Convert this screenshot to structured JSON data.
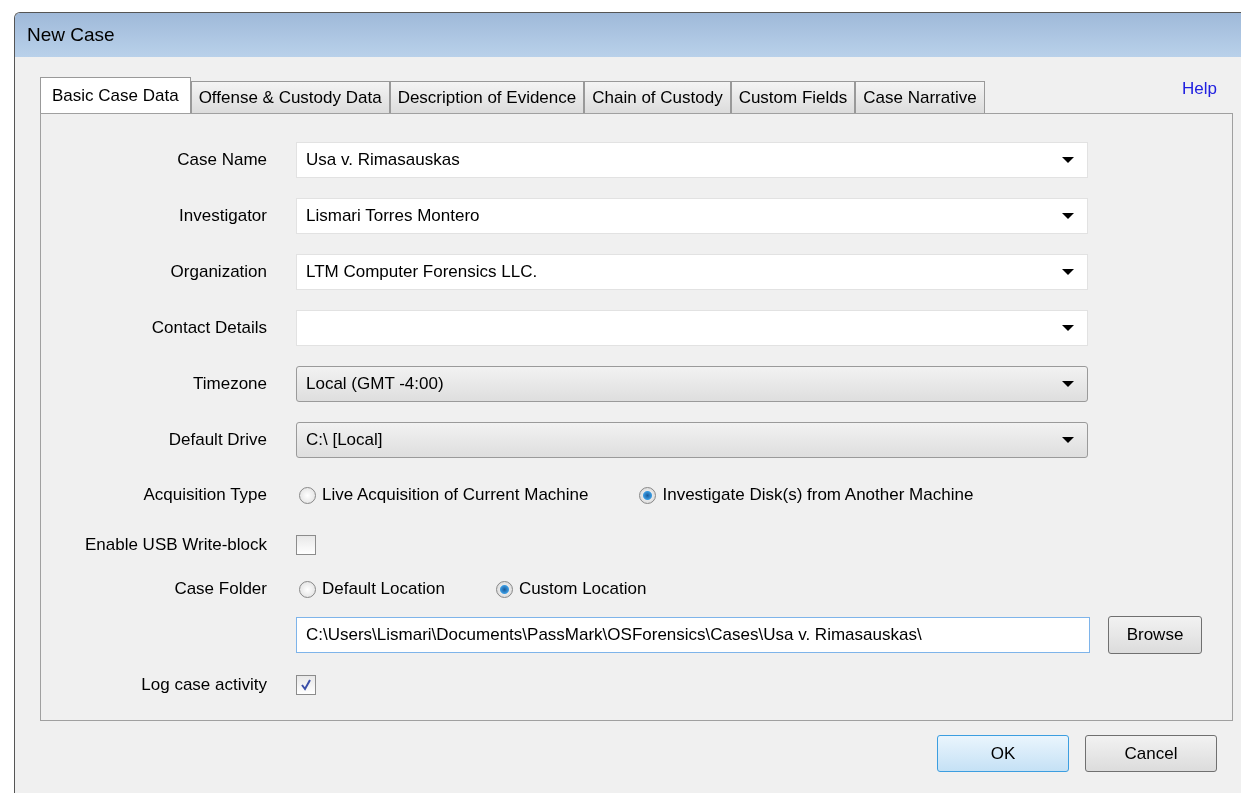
{
  "window": {
    "title": "New Case"
  },
  "tabs": [
    {
      "label": "Basic Case Data",
      "selected": true
    },
    {
      "label": "Offense & Custody Data",
      "selected": false
    },
    {
      "label": "Description of Evidence",
      "selected": false
    },
    {
      "label": "Chain of Custody",
      "selected": false
    },
    {
      "label": "Custom Fields",
      "selected": false
    },
    {
      "label": "Case Narrative",
      "selected": false
    }
  ],
  "help_link": "Help",
  "fields": [
    {
      "label": "Case Name",
      "kind": "combo",
      "value": "Usa v. Rimasauskas"
    },
    {
      "label": "Investigator",
      "kind": "combo",
      "value": "Lismari Torres Montero"
    },
    {
      "label": "Organization",
      "kind": "combo",
      "value": "LTM Computer Forensics LLC."
    },
    {
      "label": "Contact Details",
      "kind": "combo"
    },
    {
      "label": "Timezone",
      "kind": "dropdown",
      "value": "Local (GMT -4:00)"
    },
    {
      "label": "Default Drive",
      "kind": "dropdown",
      "value": "C:\\ [Local]"
    }
  ],
  "acquisition_type": {
    "label": "Acquisition Type",
    "options": [
      {
        "label": "Live Acquisition of Current Machine",
        "selected": false
      },
      {
        "label": "Investigate Disk(s) from Another Machine",
        "selected": true
      }
    ]
  },
  "usb_write_block": {
    "label": "Enable USB Write-block",
    "checked": false
  },
  "case_folder": {
    "label": "Case Folder",
    "options": [
      {
        "label": "Default Location",
        "selected": false
      },
      {
        "label": "Custom Location",
        "selected": true
      }
    ],
    "path": "C:\\Users\\Lismari\\Documents\\PassMark\\OSForensics\\Cases\\Usa v. Rimasauskas\\",
    "browse": "Browse"
  },
  "log_activity": {
    "label": "Log case activity",
    "checked": true
  },
  "buttons": [
    {
      "label": "OK",
      "default": true
    },
    {
      "label": "Cancel",
      "default": false
    }
  ]
}
